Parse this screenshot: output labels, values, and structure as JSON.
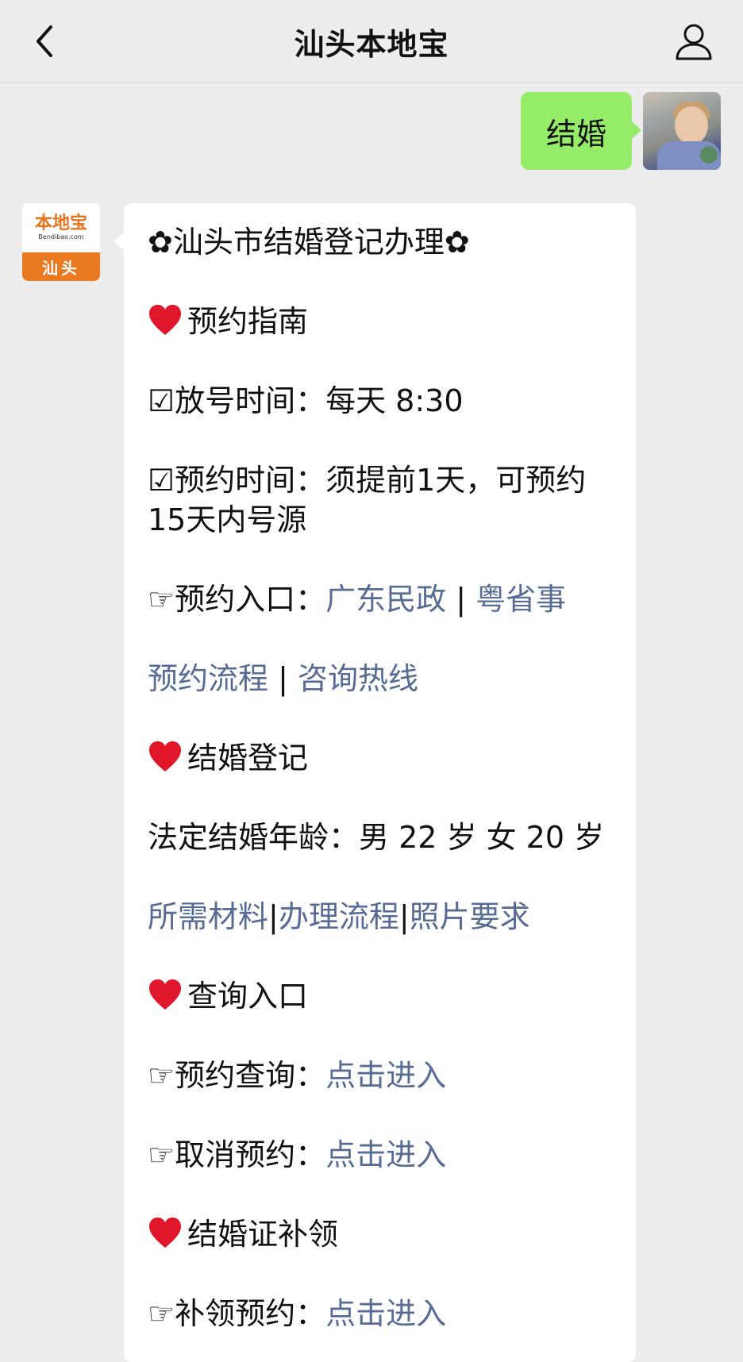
{
  "nav": {
    "title": "汕头本地宝",
    "back_icon": "chevron-left-icon",
    "user_icon": "person-icon"
  },
  "user_message": {
    "text": "结婚",
    "bubble_color": "#95ec69"
  },
  "bot": {
    "avatar": {
      "brand": "本地宝",
      "site": "Bendibao.com",
      "city": "汕头"
    },
    "title": "✿汕头市结婚登记办理✿",
    "link_color": "#576b95",
    "sections": {
      "booking_guide": {
        "heading": "预约指南",
        "release_time_label": "☑放号时间：",
        "release_time_value": "每天 8:30",
        "booking_time_label": "☑预约时间：",
        "booking_time_value": "须提前1天，可预约15天内号源",
        "entry_label": "☞预约入口：",
        "entry_link_1": "广东民政",
        "sep": "|",
        "entry_link_2": "粤省事",
        "process_link": "预约流程",
        "hotline_link": "咨询热线"
      },
      "registration": {
        "heading": "结婚登记",
        "age_text": "法定结婚年龄：男 22 岁 女 20 岁",
        "materials_link": "所需材料",
        "process_link": "办理流程",
        "photo_link": "照片要求"
      },
      "query": {
        "heading": "查询入口",
        "query_label": "☞预约查询：",
        "query_link": "点击进入",
        "cancel_label": "☞取消预约：",
        "cancel_link": "点击进入"
      },
      "reissue": {
        "heading": "结婚证补领",
        "reissue_label": "☞补领预约：",
        "reissue_link": "点击进入"
      }
    }
  }
}
